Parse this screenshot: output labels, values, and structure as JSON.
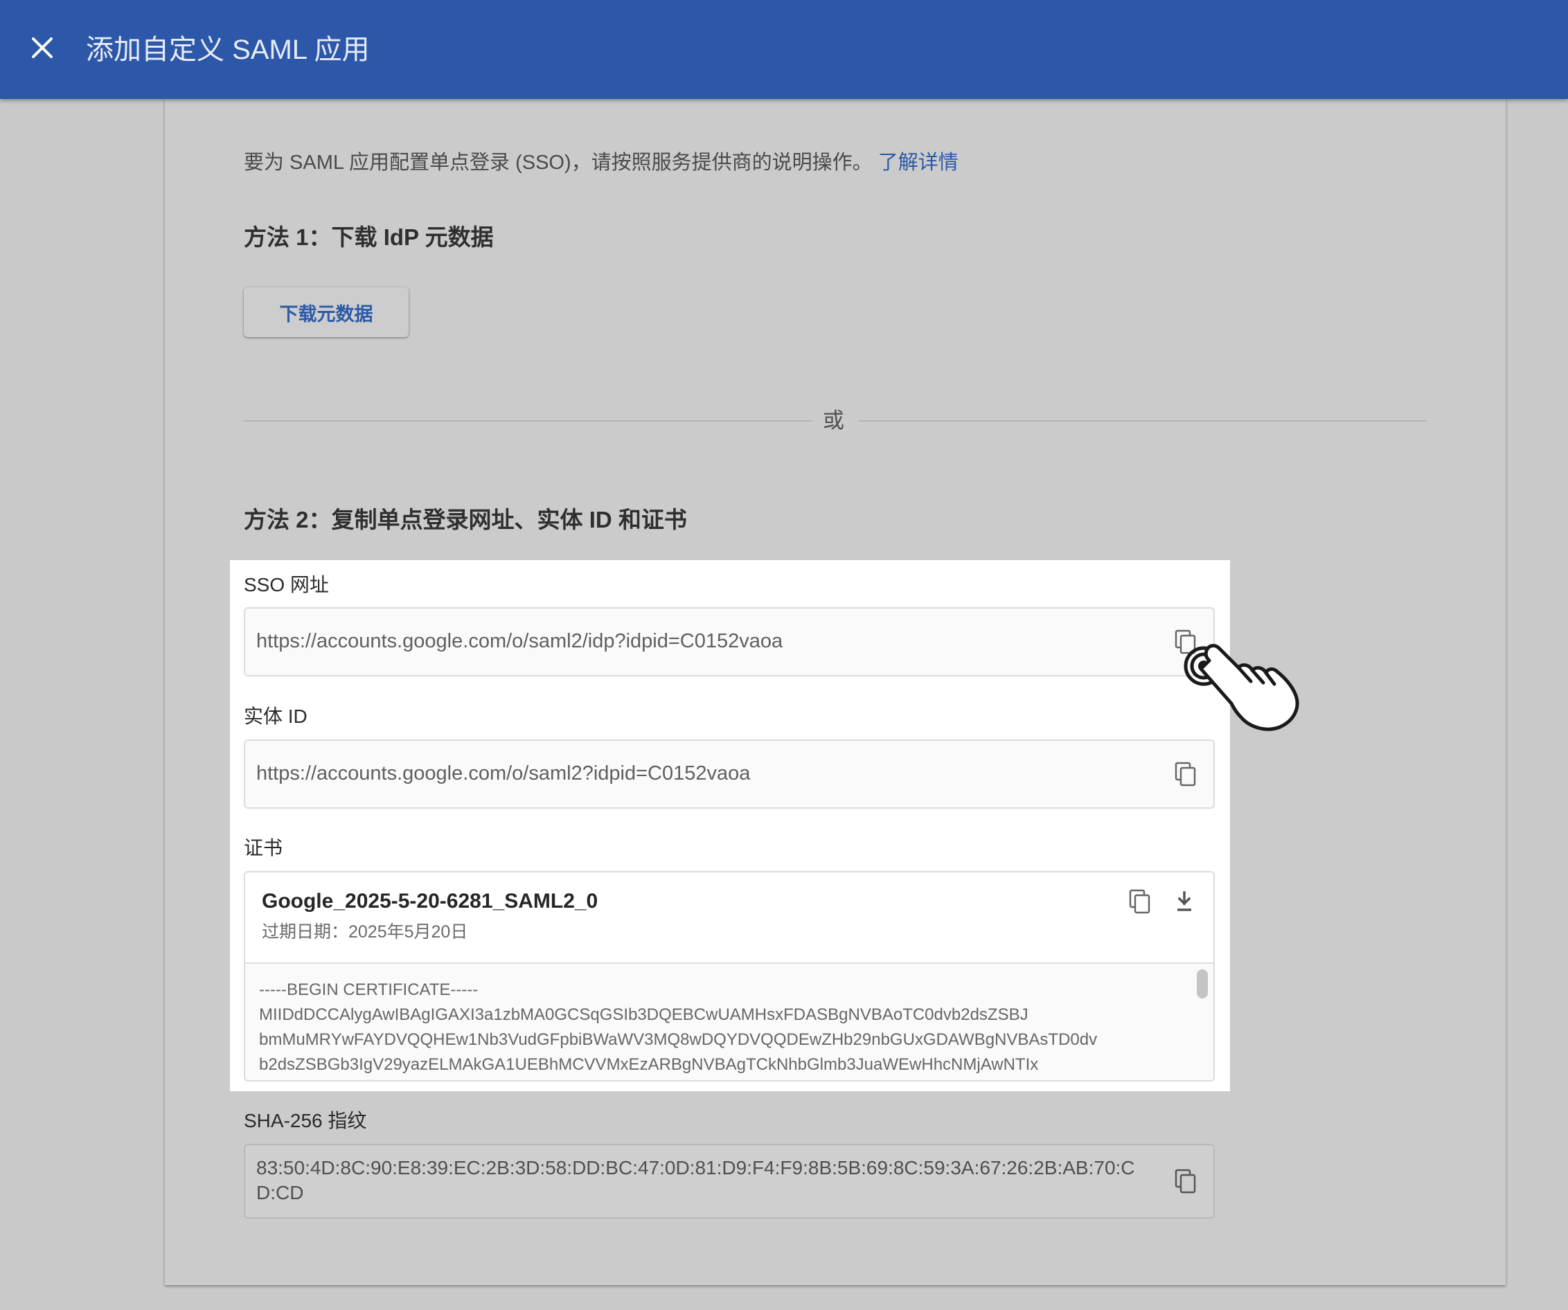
{
  "header": {
    "title": "添加自定义 SAML 应用"
  },
  "intro": {
    "text": "要为 SAML 应用配置单点登录 (SSO)，请按照服务提供商的说明操作。",
    "link": "了解详情"
  },
  "method1": {
    "title": "方法 1：下载 IdP 元数据",
    "button_label": "下载元数据"
  },
  "divider": {
    "text": "或"
  },
  "method2": {
    "title": "方法 2：复制单点登录网址、实体 ID 和证书",
    "sso": {
      "label": "SSO 网址",
      "value": "https://accounts.google.com/o/saml2/idp?idpid=C0152vaoa"
    },
    "entity": {
      "label": "实体 ID",
      "value": "https://accounts.google.com/o/saml2?idpid=C0152vaoa"
    },
    "certificate": {
      "label": "证书",
      "name": "Google_2025-5-20-6281_SAML2_0",
      "expiry": "过期日期：2025年5月20日",
      "lines": [
        "-----BEGIN CERTIFICATE-----",
        "MIIDdDCCAlygAwIBAgIGAXI3a1zbMA0GCSqGSIb3DQEBCwUAMHsxFDASBgNVBAoTC0dvb2dsZSBJ",
        "bmMuMRYwFAYDVQQHEw1Nb3VudGFpbiBWaWV3MQ8wDQYDVQQDEwZHb29nbGUxGDAWBgNVBAsTD0dv",
        "b2dsZSBGb3IgV29yazELMAkGA1UEBhMCVVMxEzARBgNVBAgTCkNhbGlmb3JuaWEwHhcNMjAwNTIx"
      ]
    },
    "sha": {
      "label": "SHA-256 指纹",
      "line1": "83:50:4D:8C:90:E8:39:EC:2B:3D:58:DD:BC:47:0D:81:D9:F4:F9:8B:5B:69:8C:59:3A:67:26:2B:AB:70:C",
      "line2": "D:CD"
    }
  },
  "icons": {
    "close": "close-icon",
    "copy": "copy-icon",
    "download": "download-icon",
    "cursor": "pointer-hand-icon"
  },
  "colors": {
    "header_bg": "#2d57a8",
    "link": "#2c5ba8",
    "overlay_bg": "#c9c9c9",
    "highlight_bg": "#ffffff"
  }
}
